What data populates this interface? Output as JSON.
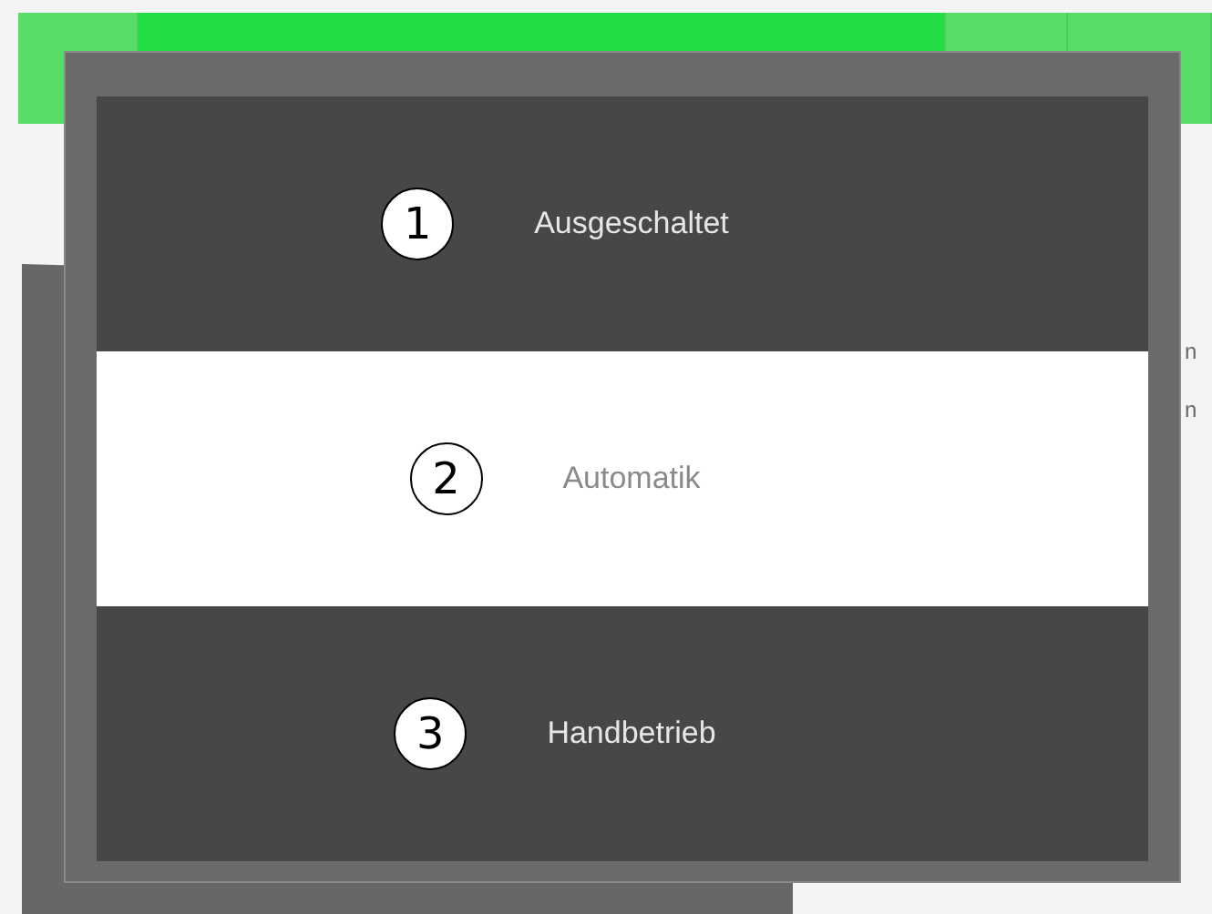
{
  "background_app": {
    "header_tabs": [
      {
        "selected": false
      },
      {
        "selected": true
      },
      {
        "selected": false
      },
      {
        "selected": false
      }
    ],
    "side_texts": [
      "n",
      "n"
    ]
  },
  "dialog": {
    "options": [
      {
        "marker": "1",
        "label": "Ausgeschaltet",
        "selected": false
      },
      {
        "marker": "2",
        "label": "Automatik",
        "selected": true
      },
      {
        "marker": "3",
        "label": "Handbetrieb",
        "selected": false
      }
    ]
  }
}
